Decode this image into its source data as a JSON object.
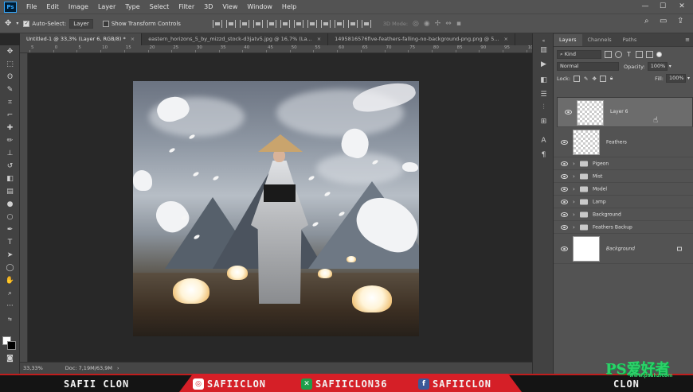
{
  "app": {
    "logo": "Ps"
  },
  "menu": [
    "File",
    "Edit",
    "Image",
    "Layer",
    "Type",
    "Select",
    "Filter",
    "3D",
    "View",
    "Window",
    "Help"
  ],
  "options": {
    "auto_select_label": "Auto-Select:",
    "auto_select_target": "Layer",
    "show_transform_label": "Show Transform Controls",
    "mode_3d_label": "3D Mode:"
  },
  "tabs": [
    {
      "label": "Untitled-1 @ 33,3% (Layer 6, RGB/8) *",
      "close": "×"
    },
    {
      "label": "eastern_horizons_5_by_mizzd_stock-d3jatv5.jpg @ 16,7% (La...",
      "close": "×"
    },
    {
      "label": "1495816576five-feathers-falling-no-background-png.png @ 5...",
      "close": "×"
    }
  ],
  "ruler_h": [
    "5",
    "0",
    "5",
    "10",
    "15",
    "20",
    "25",
    "30",
    "35",
    "40",
    "45",
    "50",
    "55",
    "60",
    "65",
    "70",
    "75",
    "80",
    "85",
    "90",
    "95",
    "100"
  ],
  "status": {
    "zoom": "33,33%",
    "doc": "Doc: 7,19M/63,9M"
  },
  "panel": {
    "tabs": [
      "Layers",
      "Channels",
      "Paths"
    ],
    "filter_kind": "Kind",
    "blend_mode": "Normal",
    "opacity_label": "Opacity:",
    "opacity_value": "100%",
    "lock_label": "Lock:",
    "fill_label": "Fill:",
    "fill_value": "100%",
    "layers": [
      {
        "name": "Layer 6",
        "type": "pixel",
        "selected": true
      },
      {
        "name": "Feathers",
        "type": "pixel",
        "selected": false
      },
      {
        "name": "Pigeon",
        "type": "group"
      },
      {
        "name": "Mist",
        "type": "group"
      },
      {
        "name": "Model",
        "type": "group"
      },
      {
        "name": "Lamp",
        "type": "group"
      },
      {
        "name": "Background",
        "type": "group"
      },
      {
        "name": "Feathers Backup",
        "type": "group"
      },
      {
        "name": "Background",
        "type": "background"
      }
    ]
  },
  "banner": {
    "name": "SAFII CLON",
    "instagram": "SAFIICLON",
    "xing": "SAFIICLON36",
    "facebook": "SAFIICLON",
    "tail": "CLON"
  },
  "watermark": {
    "main": "PS爱好者",
    "sub": "www.psahz.com"
  },
  "colors": {
    "accent": "#31a8ff",
    "banner_red": "#d51f27",
    "watermark_green": "#2fd06a"
  }
}
